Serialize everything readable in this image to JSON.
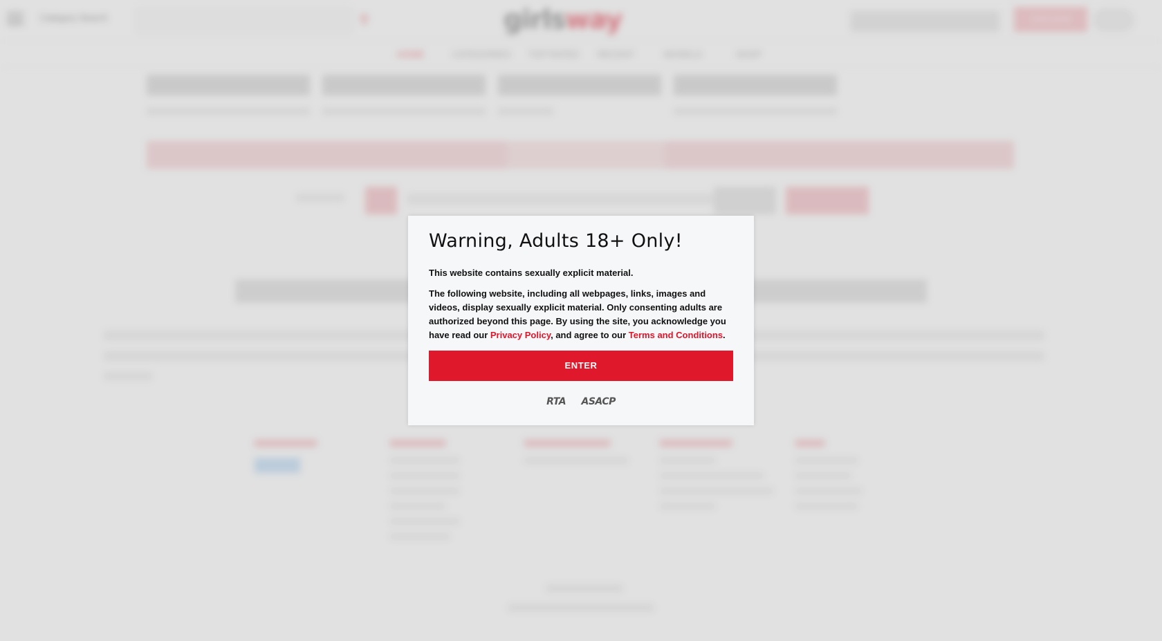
{
  "header": {
    "category_select": "Category Search",
    "logo_part1": "girls",
    "logo_part2": "way",
    "join_label": "JOIN NOW"
  },
  "nav": {
    "items": [
      "HOME",
      "CATEGORIES",
      "TOP RATED",
      "RECENT",
      "MODELS",
      "SHOP"
    ]
  },
  "modal": {
    "title": "Warning, Adults 18+ Only!",
    "lead": "This website contains sexually explicit material.",
    "body_pre": "The following website, including all webpages, links, images and videos, display sexually explicit material. Only consenting adults are authorized beyond this page. By using the site, you acknowledge you have read our ",
    "privacy_link": "Privacy Policy",
    "body_mid": ", and agree to our ",
    "terms_link": "Terms and Conditions",
    "body_end": ".",
    "enter_label": "ENTER",
    "badge_rta": "RTA",
    "badge_asacp": "ASACP"
  },
  "colors": {
    "accent": "#e0182b",
    "modal_bg": "#f6f7f9"
  },
  "icons": {
    "menu": "hamburger-icon",
    "search": "search-icon",
    "user": "user-icon"
  }
}
